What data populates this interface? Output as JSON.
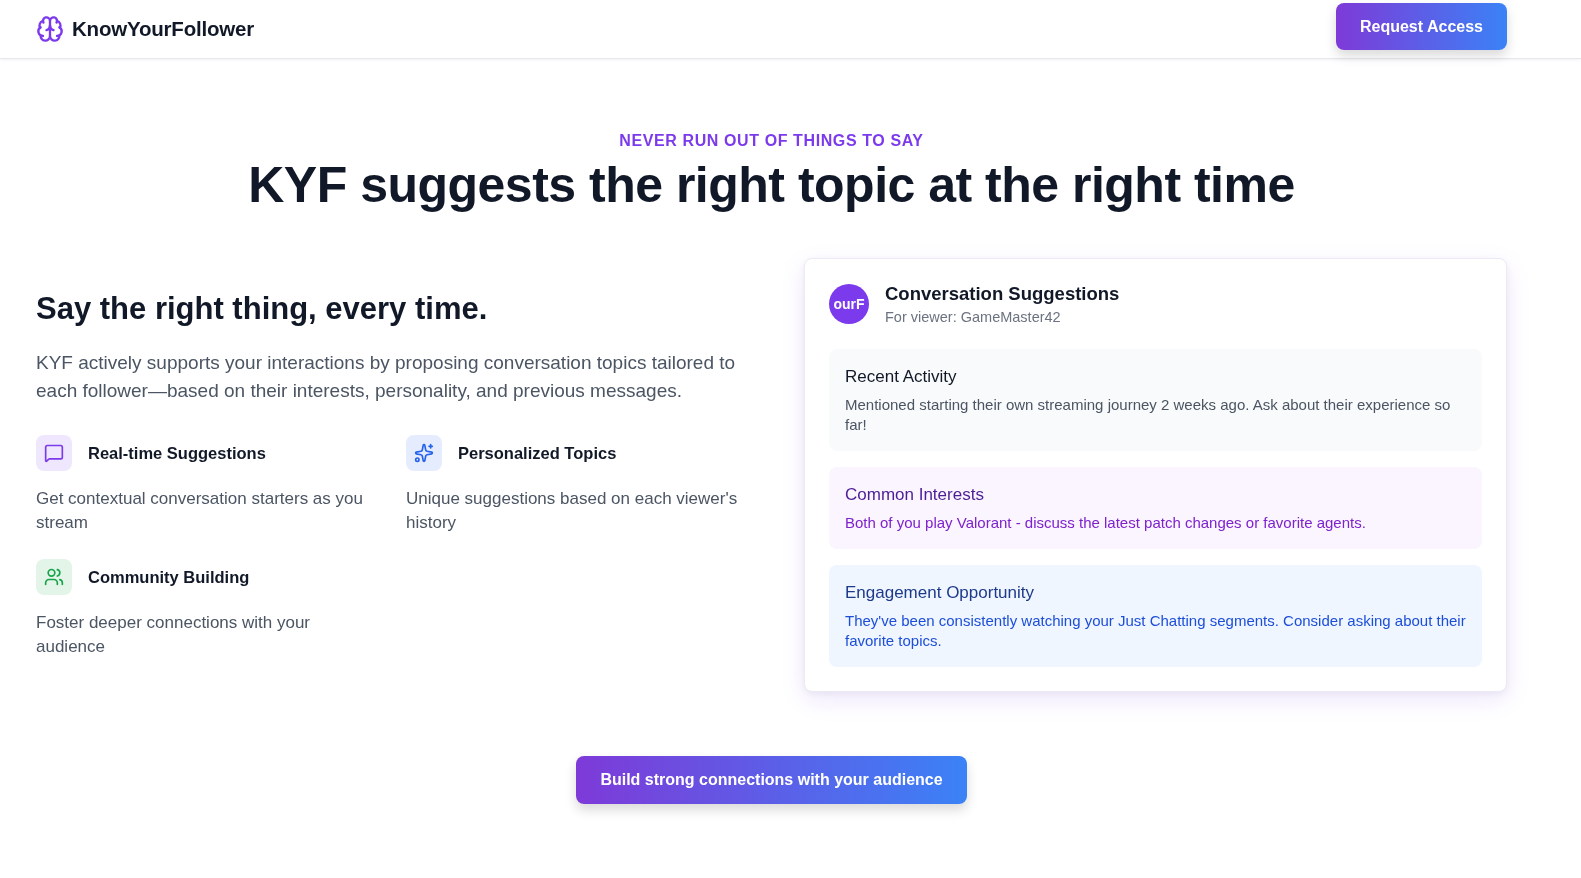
{
  "header": {
    "brand": "KnowYourFollower",
    "cta": "Request Access"
  },
  "hero": {
    "eyebrow": "NEVER RUN OUT OF THINGS TO SAY",
    "title": "KYF suggests the right topic at the right time"
  },
  "intro": {
    "heading": "Say the right thing, every time.",
    "body": "KYF actively supports your interactions by proposing conversation topics tailored to each follower—based on their interests, personality, and previous messages."
  },
  "features": [
    {
      "kind": "chat",
      "color": "#7c3aed",
      "title": "Real-time Suggestions",
      "description": "Get contextual conversation starters as you stream"
    },
    {
      "kind": "sparkles",
      "color": "#2563eb",
      "title": "Personalized Topics",
      "description": "Unique suggestions based on each viewer's history"
    },
    {
      "kind": "users",
      "color": "#16a34a",
      "title": "Community Building",
      "description": "Foster deeper connections with your audience"
    }
  ],
  "suggestions_card": {
    "avatar_text": "ourF",
    "title": "Conversation Suggestions",
    "subtitle": "For viewer: GameMaster42",
    "sections": [
      {
        "kind": "neutral",
        "title": "Recent Activity",
        "body": "Mentioned starting their own streaming journey 2 weeks ago. Ask about their experience so far!"
      },
      {
        "kind": "purple",
        "title": "Common Interests",
        "body": "Both of you play Valorant - discuss the latest patch changes or favorite agents."
      },
      {
        "kind": "blue",
        "title": "Engagement Opportunity",
        "body": "They've been consistently watching your Just Chatting segments. Consider asking about their favorite topics."
      }
    ]
  },
  "footer_cta": "Build strong connections with your audience"
}
